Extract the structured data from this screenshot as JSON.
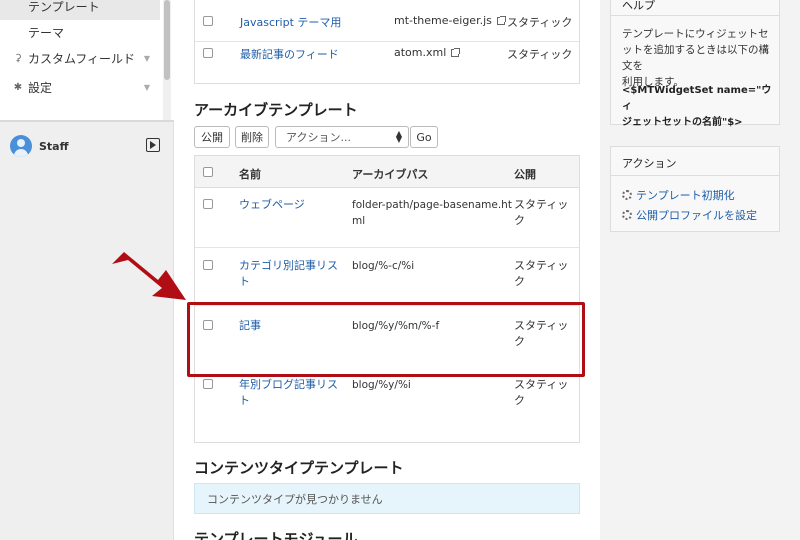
{
  "sidebar": {
    "items": [
      {
        "label": "テンプレート",
        "icon": "",
        "has_chevron": false
      },
      {
        "label": "テーマ",
        "icon": "",
        "has_chevron": false
      },
      {
        "label": "カスタムフィールド",
        "icon": "custom-field-icon",
        "has_chevron": true
      },
      {
        "label": "設定",
        "icon": "gear-icon",
        "has_chevron": true
      }
    ],
    "user": {
      "name": "Staff"
    }
  },
  "top_table": {
    "rows": [
      {
        "name": "Javascript テーマ用",
        "path": "mt-theme-eiger.js",
        "publish": "スタティック"
      },
      {
        "name": "最新記事のフィード",
        "path": "atom.xml",
        "publish": "スタティック"
      }
    ]
  },
  "archive": {
    "title": "アーカイブテンプレート",
    "toolbar": {
      "publish": "公開",
      "delete": "削除",
      "action_placeholder": "アクション...",
      "go": "Go"
    },
    "columns": {
      "name": "名前",
      "path": "アーカイブパス",
      "publish": "公開"
    },
    "rows": [
      {
        "name": [
          "ウェブページ"
        ],
        "path": [
          "folder-path/page-basename.ht",
          "ml"
        ],
        "publish": [
          "スタティッ",
          "ク"
        ]
      },
      {
        "name": [
          "カテゴリ別記事リス",
          "ト"
        ],
        "path": [
          "blog/%-c/%i"
        ],
        "publish": [
          "スタティッ",
          "ク"
        ]
      },
      {
        "name": [
          "記事"
        ],
        "path": [
          "blog/%y/%m/%-f"
        ],
        "publish": [
          "スタティッ",
          "ク"
        ]
      },
      {
        "name": [
          "年別ブログ記事リス",
          "ト"
        ],
        "path": [
          "blog/%y/%i"
        ],
        "publish": [
          "スタティッ",
          "ク"
        ]
      }
    ]
  },
  "content_type": {
    "title": "コンテンツタイプテンプレート",
    "empty_message": "コンテンツタイプが見つかりません"
  },
  "module": {
    "title": "テンプレートモジュール"
  },
  "help": {
    "title": "ヘルプ",
    "text": [
      "テンプレートにウィジェットセ",
      "ットを追加するときは以下の構文を",
      "利用します。"
    ],
    "code": [
      "<$MTWidgetSet name=\"ウィ",
      "ジェットセットの名前\"$>"
    ]
  },
  "actions": {
    "title": "アクション",
    "links": [
      "テンプレート初期化",
      "公開プロファイルを設定"
    ]
  },
  "colors": {
    "highlight": "#b10d14",
    "link": "#1f5ea8",
    "info_bg": "#e6f4fb"
  }
}
